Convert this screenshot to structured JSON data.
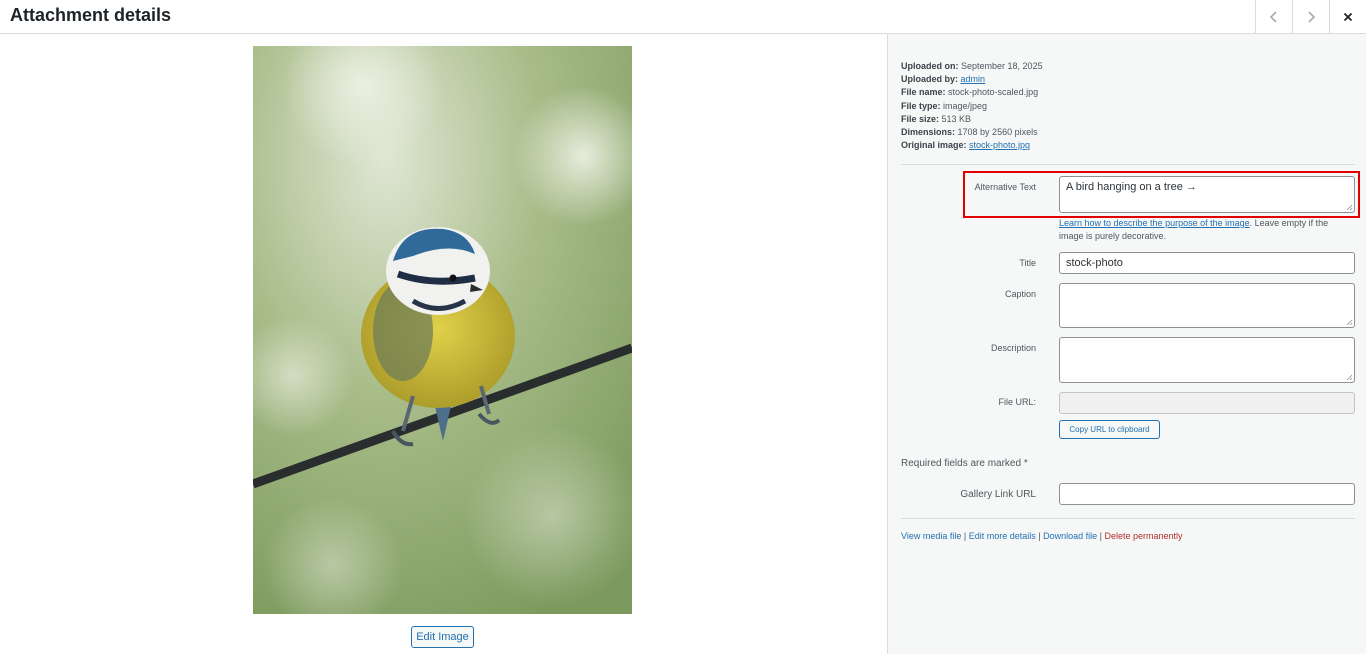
{
  "header": {
    "title": "Attachment details",
    "prev_icon": "chevron-left-icon",
    "next_icon": "chevron-right-icon",
    "close_icon": "close-icon"
  },
  "preview": {
    "image_subject": "blue tit bird perched on a wire",
    "edit_button": "Edit Image"
  },
  "meta": {
    "uploaded_on_label": "Uploaded on:",
    "uploaded_on": "September 18, 2025",
    "uploaded_by_label": "Uploaded by:",
    "uploaded_by": "admin",
    "file_name_label": "File name:",
    "file_name": "stock-photo-scaled.jpg",
    "file_type_label": "File type:",
    "file_type": "image/jpeg",
    "file_size_label": "File size:",
    "file_size": "513 KB",
    "dimensions_label": "Dimensions:",
    "dimensions": "1708 by 2560 pixels",
    "original_label": "Original image:",
    "original": "stock-photo.jpg"
  },
  "form": {
    "alt_label": "Alternative Text",
    "alt_value": "A bird hanging on a tree →",
    "alt_help_link": "Learn how to describe the purpose of the image",
    "alt_help_text": ". Leave empty if the image is purely decorative.",
    "title_label": "Title",
    "title_value": "stock-photo",
    "caption_label": "Caption",
    "caption_value": "",
    "description_label": "Description",
    "description_value": "",
    "file_url_label": "File URL:",
    "file_url_value": "",
    "copy_button": "Copy URL to clipboard",
    "required_note": "Required fields are marked *",
    "gallery_label": "Gallery Link URL",
    "gallery_value": ""
  },
  "actions": {
    "view": "View media file",
    "edit": "Edit more details",
    "download": "Download file",
    "delete": "Delete permanently",
    "separator": " | "
  },
  "colors": {
    "accent": "#2271b1",
    "danger": "#b32d2e",
    "highlight": "#e00000",
    "sidebar_bg": "#f6f7f7"
  }
}
